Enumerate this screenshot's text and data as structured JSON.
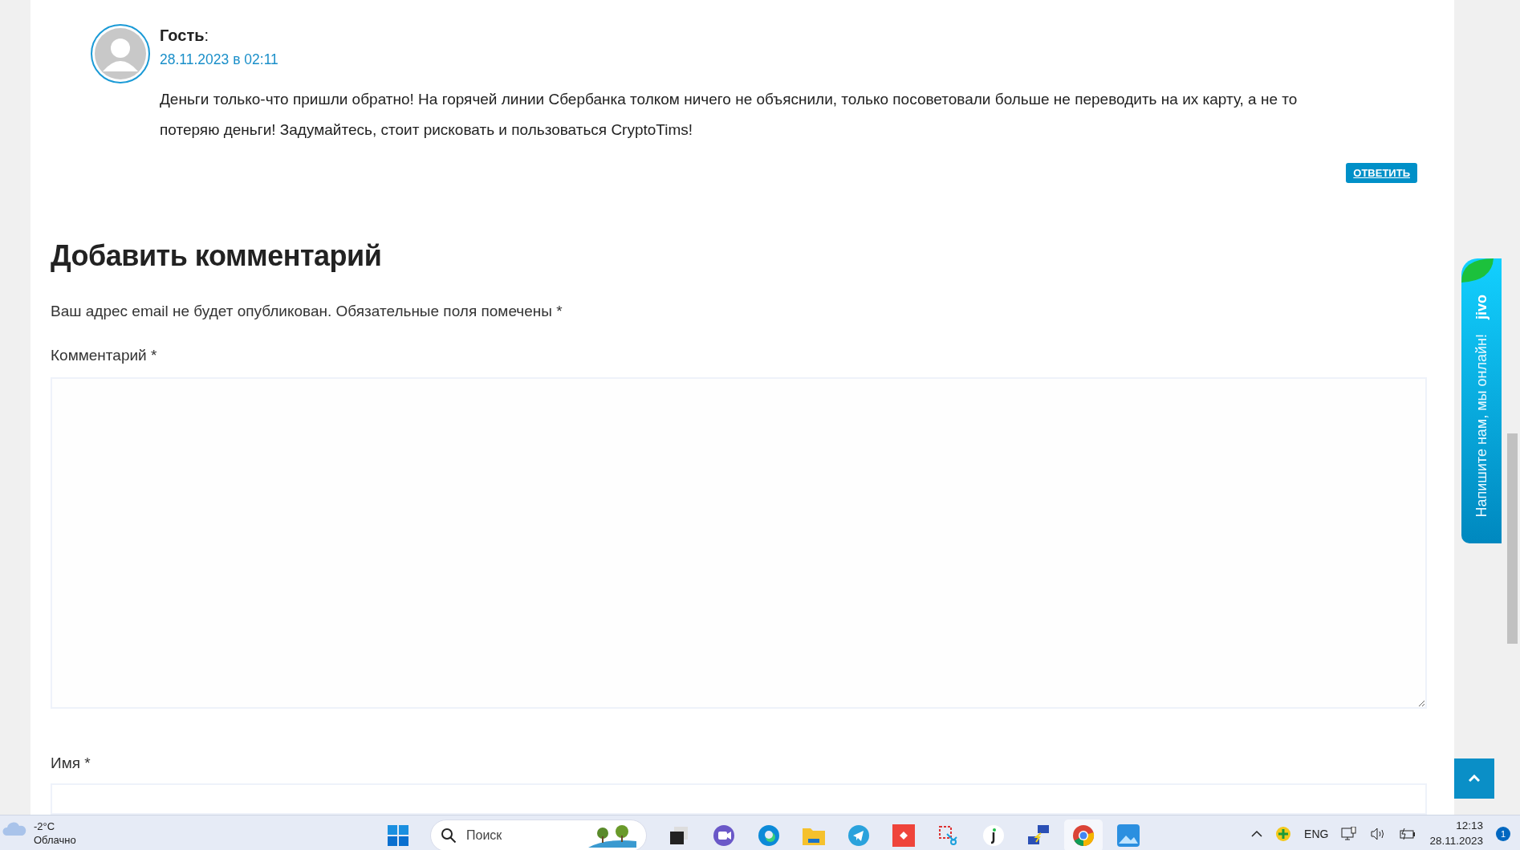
{
  "comment": {
    "author": "Гость",
    "author_suffix": ":",
    "date": "28.11.2023 в 02:11",
    "text": "Деньги только-что пришли обратно! На горячей линии Сбербанка толком ничего не объяснили, только посоветовали больше не переводить на их карту, а не то потеряю деньги! Задумайтесь, стоит рисковать и пользоваться CryptoTims!",
    "reply": "ОТВЕТИТЬ"
  },
  "form": {
    "title": "Добавить комментарий",
    "note": "Ваш адрес email не будет опубликован. Обязательные поля помечены *",
    "comment_label": "Комментарий *",
    "name_label": "Имя *"
  },
  "chat_widget": {
    "logo": "jivo",
    "text": "Напишите нам, мы онлайн!"
  },
  "taskbar": {
    "weather": {
      "temp": "-2°C",
      "condition": "Облачно"
    },
    "search": {
      "placeholder": "Поиск"
    },
    "apps": [
      {
        "kind": "taskview",
        "selected": false
      },
      {
        "kind": "meet",
        "selected": false
      },
      {
        "kind": "edge",
        "selected": false
      },
      {
        "kind": "folder",
        "selected": false
      },
      {
        "kind": "telegram",
        "selected": false
      },
      {
        "kind": "anydesk",
        "selected": false
      },
      {
        "kind": "snip",
        "selected": false
      },
      {
        "kind": "jivo",
        "selected": false
      },
      {
        "kind": "network",
        "selected": false
      },
      {
        "kind": "chrome",
        "selected": true
      },
      {
        "kind": "photos",
        "selected": false
      }
    ],
    "language": "ENG",
    "time": "12:13",
    "date": "28.11.2023",
    "notifications": "1"
  }
}
